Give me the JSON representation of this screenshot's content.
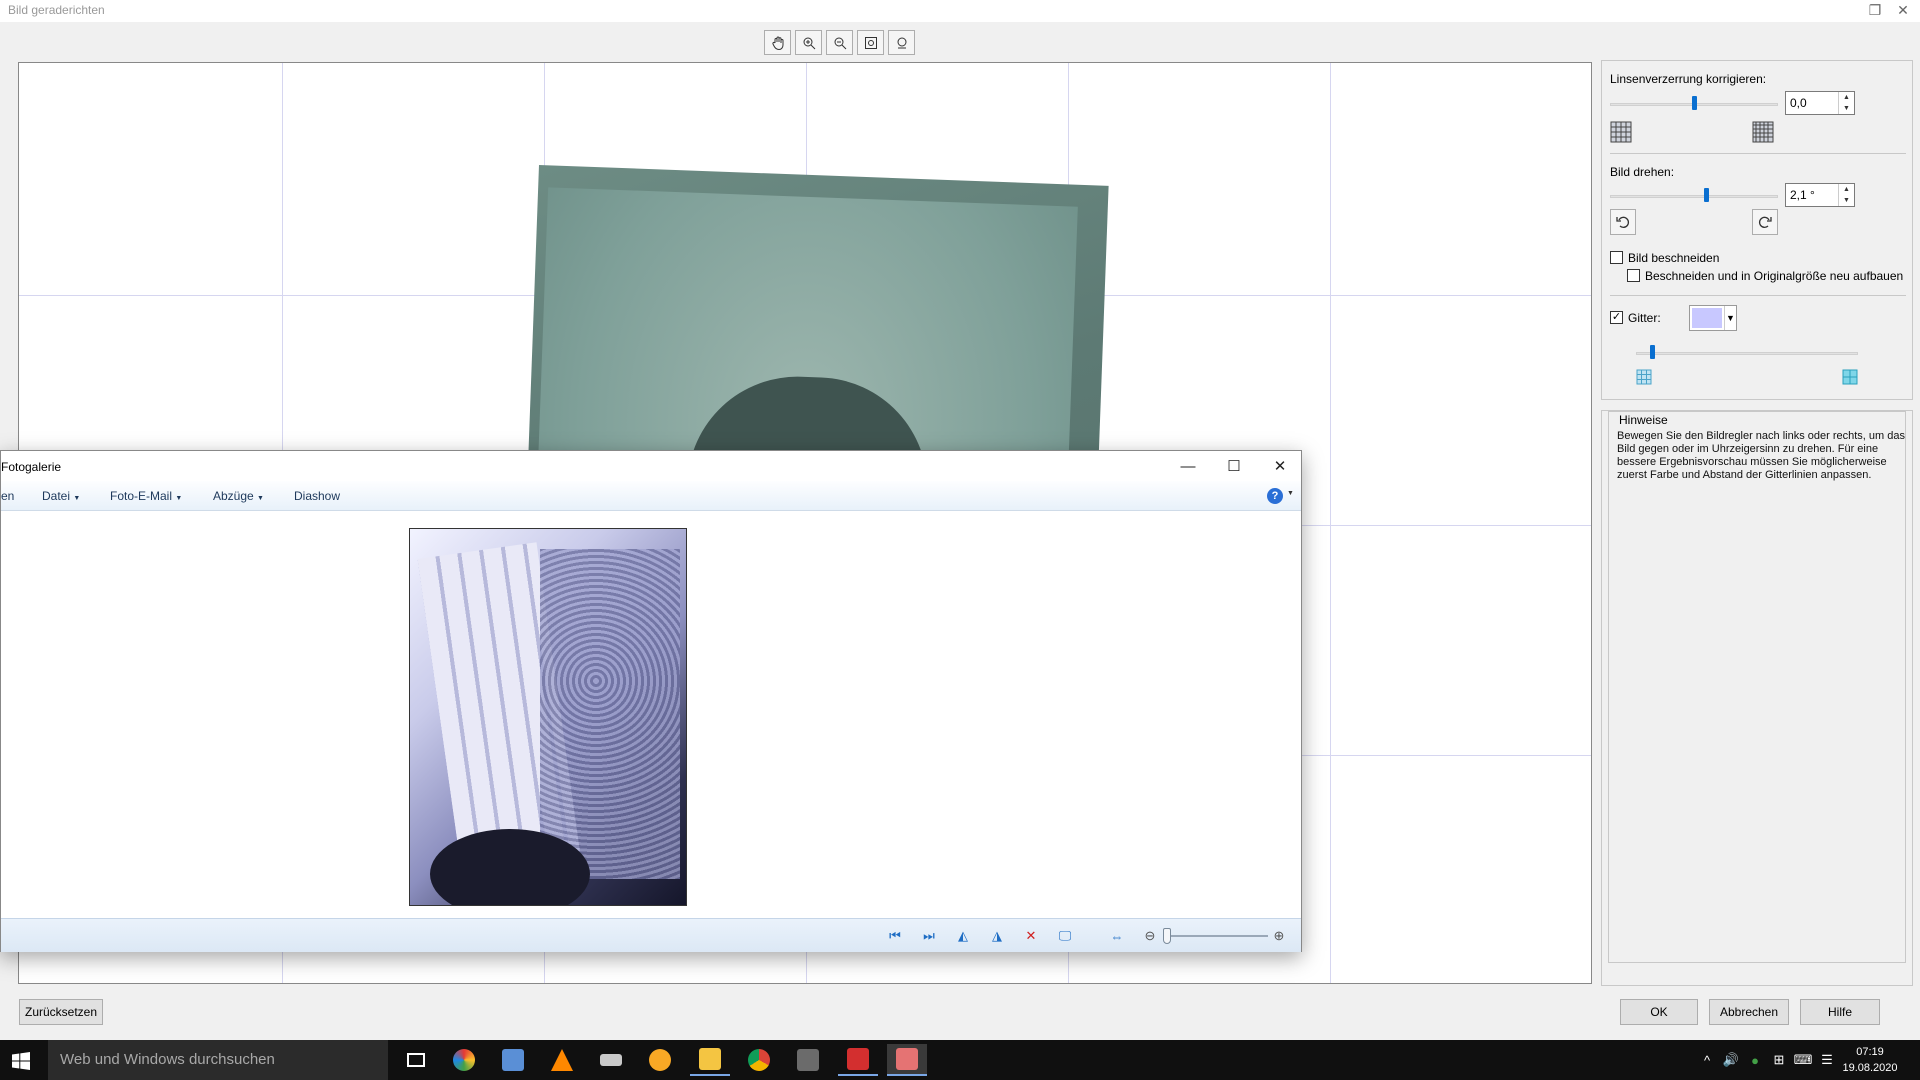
{
  "window": {
    "title": "Bild geraderichten"
  },
  "lens": {
    "label": "Linsenverzerrung korrigieren:",
    "value": "0,0",
    "slider_fraction": 0.5
  },
  "rotate": {
    "label": "Bild drehen:",
    "value": "2,1 °",
    "slider_fraction": 0.57
  },
  "crop": {
    "label": "Bild beschneiden",
    "checked": false,
    "sub_label": "Beschneiden und in Originalgröße neu aufbauen",
    "sub_checked": false
  },
  "grid": {
    "label": "Gitter:",
    "checked": true,
    "color": "#c8c8ff",
    "slider_fraction": 0.07
  },
  "hints": {
    "title": "Hinweise",
    "text": "Bewegen Sie den Bildregler nach links oder rechts, um das Bild gegen oder im Uhrzeigersinn zu drehen. Für eine bessere Ergebnisvorschau müssen Sie möglicherweise zuerst Farbe und Abstand der Gitterlinien anpassen."
  },
  "buttons": {
    "reset": "Zurücksetzen",
    "ok": "OK",
    "cancel": "Abbrechen",
    "help": "Hilfe"
  },
  "gallery": {
    "title": "Fotogalerie",
    "menu_cut": "en",
    "menu": [
      "Datei",
      "Foto-E-Mail",
      "Abzüge",
      "Diashow"
    ]
  },
  "taskbar": {
    "search_placeholder": "Web und Windows durchsuchen",
    "time": "07:19",
    "date": "19.08.2020"
  }
}
